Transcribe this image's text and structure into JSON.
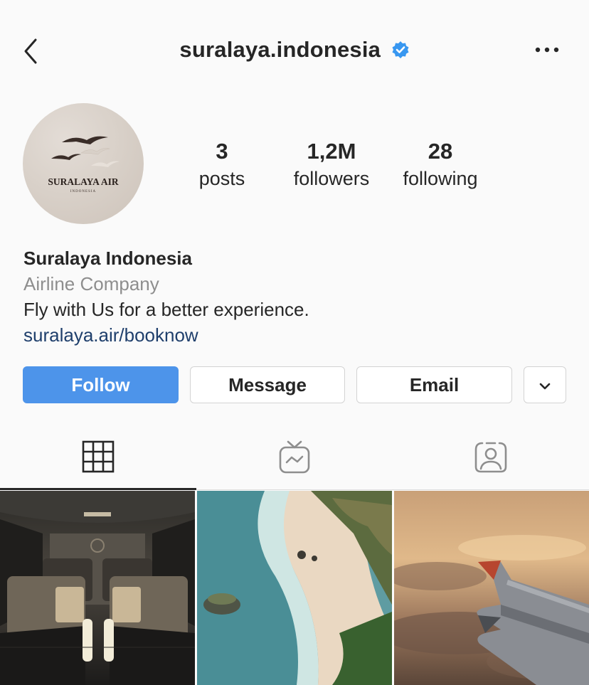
{
  "header": {
    "username": "suralaya.indonesia",
    "icons": {
      "back": "chevron-left-icon",
      "verified": "verified-badge-icon",
      "more": "more-horizontal-icon"
    },
    "verified_color": "#3897f0"
  },
  "avatar": {
    "logo_text": "SURALAYA AIR",
    "logo_subtext": "INDONESIA"
  },
  "stats": [
    {
      "value": "3",
      "label": "posts"
    },
    {
      "value": "1,2M",
      "label": "followers"
    },
    {
      "value": "28",
      "label": "following"
    }
  ],
  "bio": {
    "name": "Suralaya Indonesia",
    "category": "Airline Company",
    "description": "Fly with Us for a better experience.",
    "link": "suralaya.air/booknow"
  },
  "actions": {
    "follow": "Follow",
    "message": "Message",
    "email": "Email",
    "dropdown_icon": "chevron-down-icon"
  },
  "tabs": [
    {
      "name": "grid",
      "icon": "grid-icon",
      "active": true
    },
    {
      "name": "igtv",
      "icon": "igtv-icon",
      "active": false
    },
    {
      "name": "tagged",
      "icon": "tagged-user-icon",
      "active": false
    }
  ],
  "colors": {
    "follow_button": "#4d94ea",
    "link": "#1f3f6c",
    "muted": "#8e8e8e"
  },
  "posts": [
    {
      "subject": "airplane-cabin-seats"
    },
    {
      "subject": "beach-cliff-aerial"
    },
    {
      "subject": "airplane-wing-clouds"
    }
  ]
}
